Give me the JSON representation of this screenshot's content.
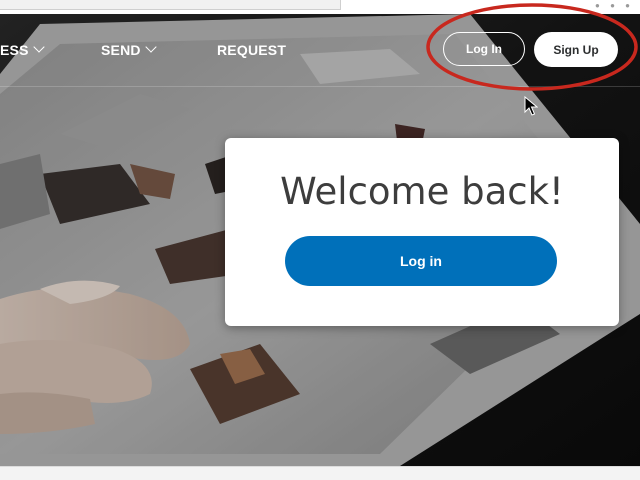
{
  "nav": {
    "business_label": "ESS",
    "send_label": "SEND",
    "request_label": "REQUEST",
    "login_label": "Log In",
    "signup_label": "Sign Up"
  },
  "card": {
    "title": "Welcome back!",
    "login_button_label": "Log in"
  },
  "colors": {
    "primary_button": "#0070ba",
    "annotation_circle": "#c8281e",
    "card_background": "#ffffff",
    "hero_overlay": "#121212"
  },
  "icons": {
    "nav_dropdown": "chevron-down-icon",
    "pointer": "cursor-icon"
  }
}
